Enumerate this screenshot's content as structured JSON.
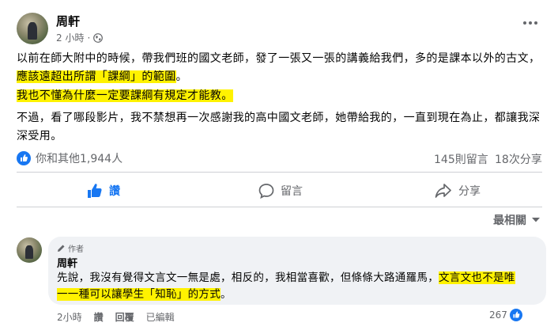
{
  "post": {
    "author": "周軒",
    "time": "2 小時",
    "dot": "·",
    "privacy_icon": "globe-icon",
    "more_icon": "ellipsis-icon",
    "para1_plain": "以前在師大附中的時候，帶我們班的國文老師，發了一張又一張的講義給我們，多的是課本以外的古文，",
    "para1_highlight": "應該遠超出所謂「課綱」的範圍",
    "para1_end": "。",
    "para2_highlight": "我也不懂為什麼一定要課綱有規定才能教。",
    "para3": "不過，看了哪段影片，我不禁想再一次感謝我的高中國文老師，她帶給我的，一直到現在為止，都讓我深深受用。"
  },
  "stats": {
    "reactions": "你和其他1,944人",
    "comments": "145則留言",
    "shares": "18次分享"
  },
  "actions": {
    "like": "讚",
    "comment": "留言",
    "share": "分享"
  },
  "sort": {
    "label": "最相關"
  },
  "comment": {
    "author_badge": "作者",
    "author": "周軒",
    "text_plain": "先說，我沒有覺得文言文一無是處，相反的，我相當喜歡，但條條大路通羅馬，",
    "text_highlight": "文言文也不是唯一一種可以讓學生「知恥」的方式",
    "text_end": "。",
    "time": "2小時",
    "like": "讚",
    "reply": "回覆",
    "edited": "已編輯",
    "like_count": "267"
  },
  "colors": {
    "accent": "#1877f2",
    "highlight": "#fff200",
    "muted": "#65676b"
  }
}
